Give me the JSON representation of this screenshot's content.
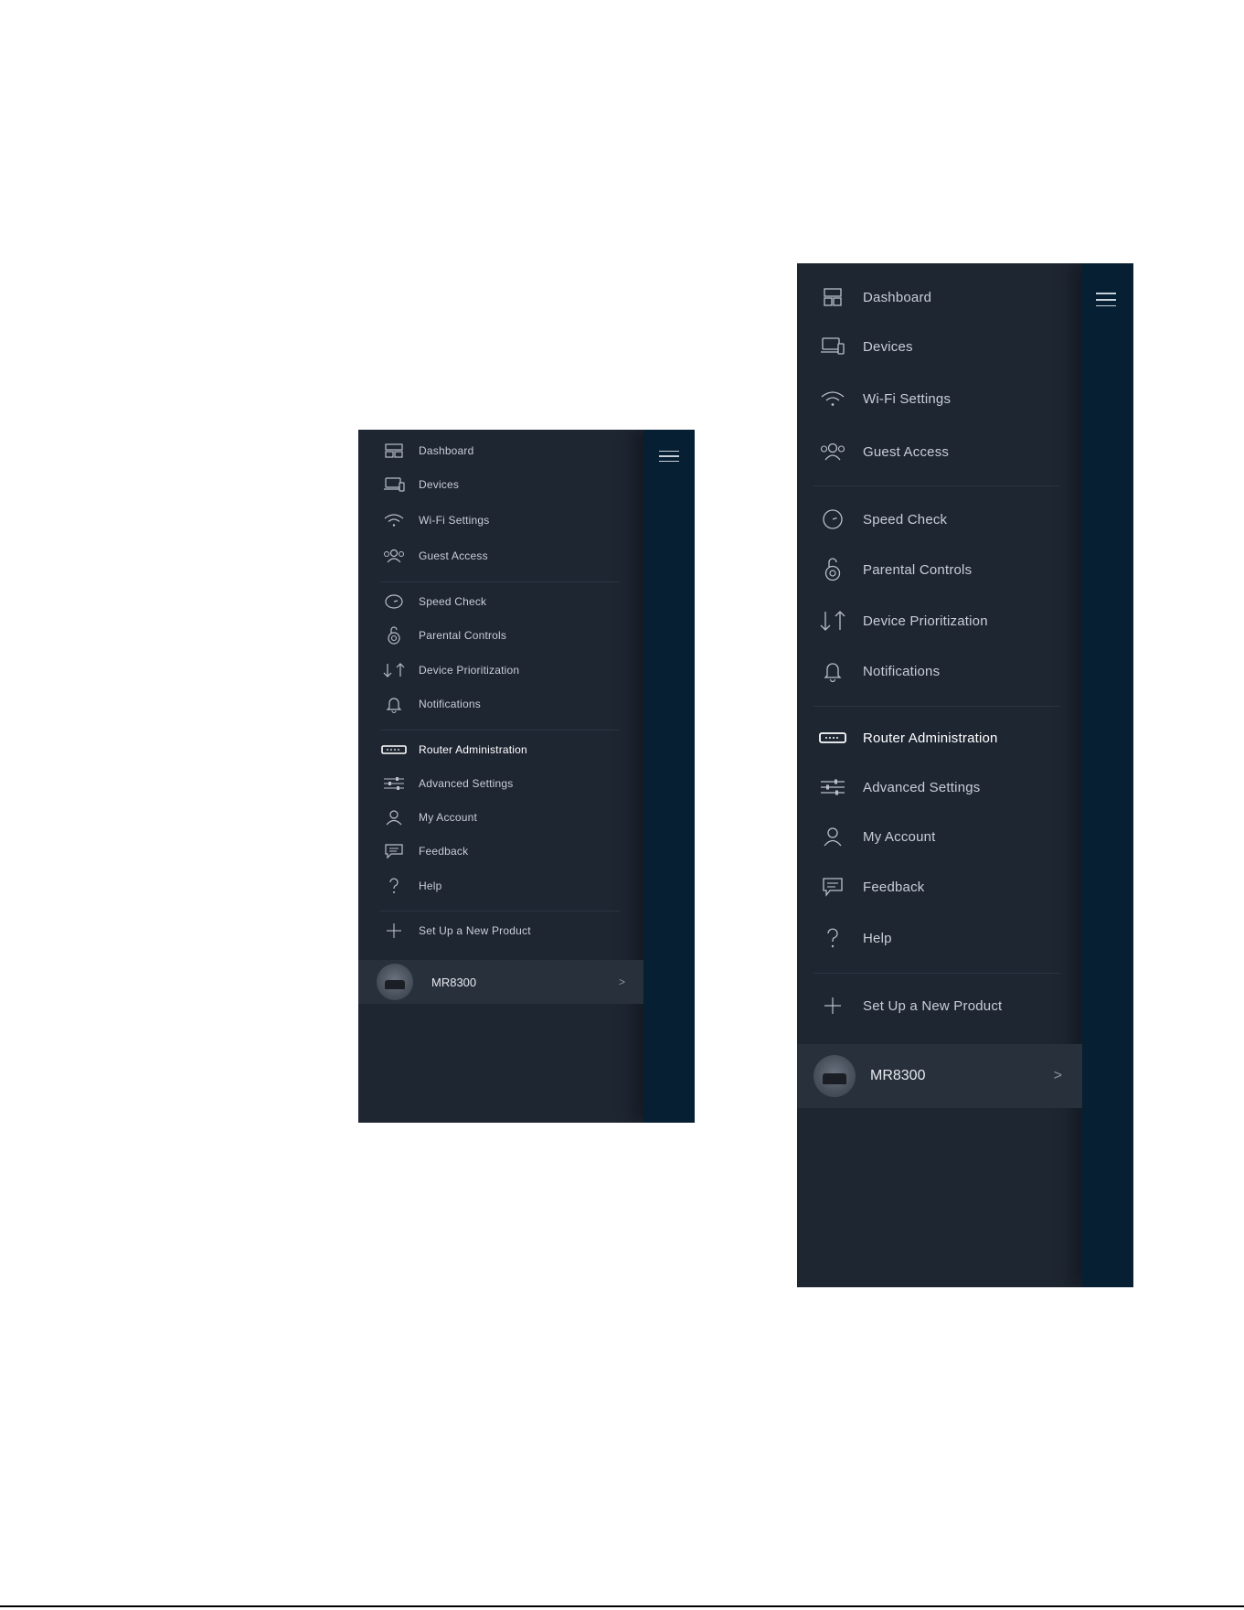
{
  "menu": {
    "items": [
      {
        "label": "Dashboard",
        "icon": "dashboard-icon"
      },
      {
        "label": "Devices",
        "icon": "devices-icon"
      },
      {
        "label": "Wi-Fi Settings",
        "icon": "wifi-icon"
      },
      {
        "label": "Guest Access",
        "icon": "guest-access-icon"
      },
      {
        "label": "Speed Check",
        "icon": "speed-check-icon"
      },
      {
        "label": "Parental Controls",
        "icon": "parental-controls-icon"
      },
      {
        "label": "Device Prioritization",
        "icon": "prioritization-icon"
      },
      {
        "label": "Notifications",
        "icon": "bell-icon"
      },
      {
        "label": "Router Administration",
        "icon": "router-icon",
        "active": true
      },
      {
        "label": "Advanced Settings",
        "icon": "sliders-icon"
      },
      {
        "label": "My Account",
        "icon": "user-icon"
      },
      {
        "label": "Feedback",
        "icon": "feedback-icon"
      },
      {
        "label": "Help",
        "icon": "help-icon"
      },
      {
        "label": "Set Up a New Product",
        "icon": "plus-icon"
      }
    ],
    "product": {
      "name": "MR8300",
      "chevron": ">"
    },
    "menu_icon": "hamburger-icon"
  },
  "colors": {
    "panel_bg": "#1e2632",
    "strip_bg": "#061f33",
    "product_bg": "#28303c",
    "active_text": "#ffffff",
    "text": "#c9ced6"
  }
}
